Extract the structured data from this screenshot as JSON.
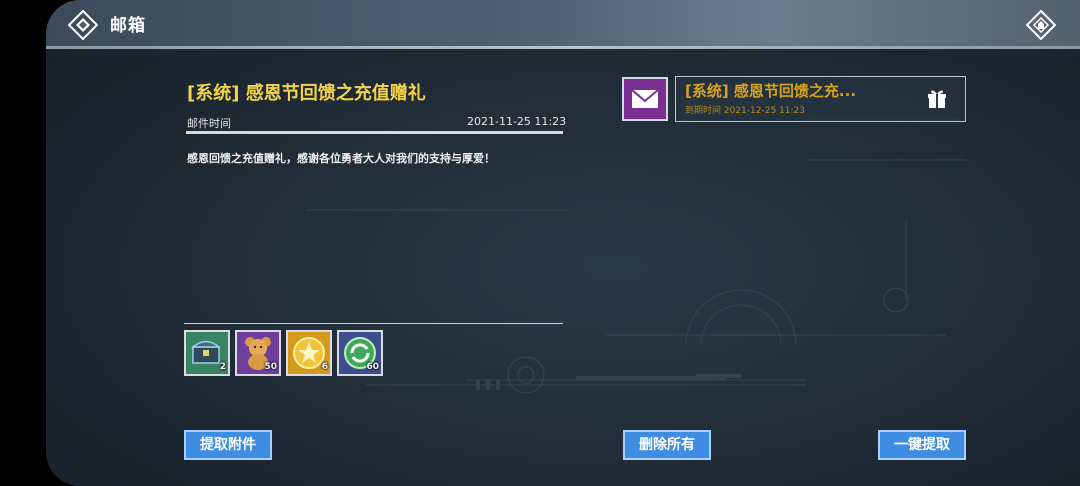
{
  "header": {
    "title": "邮箱",
    "back_icon": "back-diamond-icon",
    "home_icon": "home-diamond-icon"
  },
  "mail_detail": {
    "title": "[系统] 感恩节回馈之充值赠礼",
    "time_label": "邮件时间",
    "time_value": "2021-11-25 11:23",
    "body": "感恩回馈之充值赠礼，感谢各位勇者大人对我们的支持与厚爱！",
    "attachments": [
      {
        "name": "treasure-chest",
        "count": "2",
        "bg": "#3a8466"
      },
      {
        "name": "bear-doll",
        "count": "50",
        "bg": "#6e3d9e"
      },
      {
        "name": "gold-medal",
        "count": "6",
        "bg": "#d39a1e"
      },
      {
        "name": "refresh-orb",
        "count": "60",
        "bg": "#3c4f8a"
      }
    ],
    "claim_button": "提取附件"
  },
  "mail_list": {
    "items": [
      {
        "title": "[系统] 感恩节回馈之充...",
        "expire": "到期时间 2021-12-25 11:23",
        "icon": "envelope-icon",
        "badge_icon": "gift-icon"
      }
    ]
  },
  "actions": {
    "delete_all": "删除所有",
    "claim_all": "一键提取"
  },
  "colors": {
    "accent_yellow": "#f2d34a",
    "mail_item_gold": "#d7a21e",
    "button_blue": "#3e8de2",
    "mail_icon_purple": "#7b2f92"
  }
}
